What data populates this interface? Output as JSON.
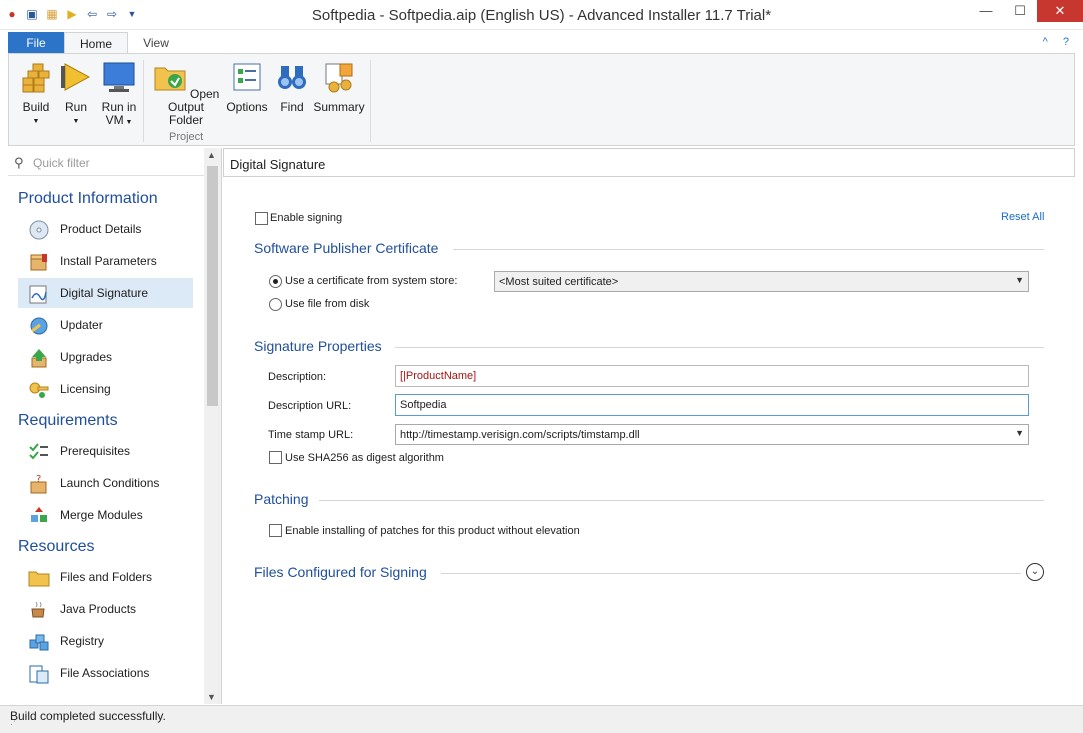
{
  "window": {
    "title": "Softpedia - Softpedia.aip (English US) - Advanced Installer 11.7 Trial*"
  },
  "ribbon": {
    "tabs": [
      "File",
      "Home",
      "View"
    ],
    "buttons": {
      "build": "Build",
      "run": "Run",
      "run_in_vm_1": "Run in",
      "run_in_vm_2": "VM",
      "open_output_1": "Open Output",
      "open_output_2": "Folder",
      "options": "Options",
      "find": "Find",
      "summary": "Summary"
    },
    "group_label": "Project"
  },
  "sidebar": {
    "filter_placeholder": "Quick filter",
    "sections": [
      {
        "title": "Product Information",
        "items": [
          "Product Details",
          "Install Parameters",
          "Digital Signature",
          "Updater",
          "Upgrades",
          "Licensing"
        ]
      },
      {
        "title": "Requirements",
        "items": [
          "Prerequisites",
          "Launch Conditions",
          "Merge Modules"
        ]
      },
      {
        "title": "Resources",
        "items": [
          "Files and Folders",
          "Java Products",
          "Registry",
          "File Associations"
        ]
      }
    ],
    "active_item": "Digital Signature"
  },
  "main": {
    "header": "Digital Signature",
    "enable_signing": "Enable signing",
    "reset_all": "Reset All",
    "publisher_cert": {
      "title": "Software Publisher Certificate",
      "option_store": "Use a certificate from system store:",
      "option_file": "Use file from disk",
      "store_value": "<Most suited certificate>"
    },
    "sig_props": {
      "title": "Signature Properties",
      "description_label": "Description:",
      "description_value": "[|ProductName]",
      "desc_url_label": "Description URL:",
      "desc_url_value": "Softpedia",
      "timestamp_label": "Time stamp URL:",
      "timestamp_value": "http://timestamp.verisign.com/scripts/timstamp.dll",
      "sha256": "Use SHA256 as digest algorithm"
    },
    "patching": {
      "title": "Patching",
      "option": "Enable installing of patches for this product without elevation"
    },
    "files_signing": {
      "title": "Files Configured for Signing"
    }
  },
  "status": {
    "text": "Build completed successfully."
  }
}
